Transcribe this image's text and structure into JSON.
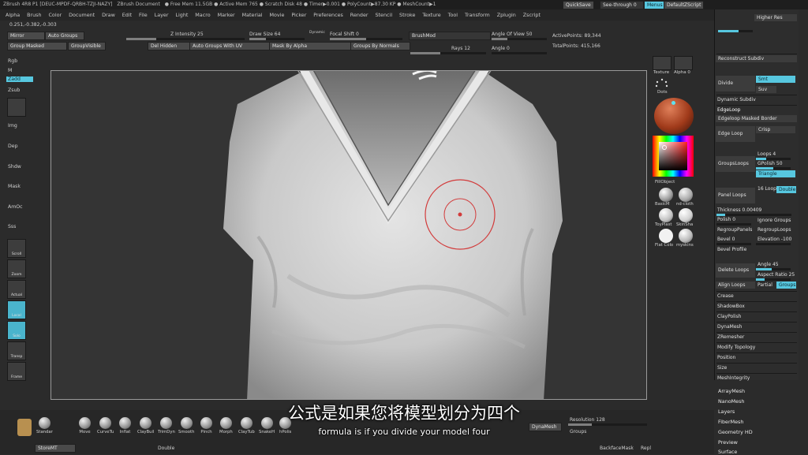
{
  "titlebar": {
    "app": "ZBrush 4R8 P1 [DEUC-MPDF-QRBH-TZJI-NAZY]",
    "doc": "ZBrush Document",
    "stats": "● Free Mem 11.5GB ● Active Mem 765 ● Scratch Disk 48 ● Timer▶0.001 ● PolyCount▶87.30 KP ● MeshCount▶1",
    "quicksave": "QuickSave",
    "seethrough": "See-through 0",
    "menus": "Menus",
    "script": "DefaultZScript"
  },
  "menu": [
    "Alpha",
    "Brush",
    "Color",
    "Document",
    "Draw",
    "Edit",
    "File",
    "Layer",
    "Light",
    "Macro",
    "Marker",
    "Material",
    "Movie",
    "Picker",
    "Preferences",
    "Render",
    "Stencil",
    "Stroke",
    "Texture",
    "Tool",
    "Transform",
    "Zplugin",
    "Zscript"
  ],
  "coords": "0.251,-0.382,-0.303",
  "toolbar": {
    "mirror": "Mirror",
    "auto_groups": "Auto Groups",
    "group_masked": "Group Masked",
    "group_visible": "GroupVisible",
    "del_hidden": "Del Hidden",
    "auto_groups_uv": "Auto Groups With UV",
    "mask_by_alpha": "Mask By Alpha",
    "groups_by_normals": "Groups By Normals",
    "z_intensity": "Z Intensity 25",
    "draw_size": "Draw Size 64",
    "dynamic": "Dynamic",
    "focal_shift": "Focal Shift 0",
    "brush_mod": "BrushMod",
    "angle_of_view": "Angle Of View 50",
    "rays": "Rays 12",
    "angle": "Angle 0",
    "active_points": "ActivePoints: 89,344",
    "total_points": "TotalPoints: 415,166"
  },
  "left_labels": [
    "Rgb",
    "M",
    "Zadd",
    "Zsub",
    "Img",
    "Dep",
    "Shdw",
    "Mask",
    "AmOc",
    "Sss"
  ],
  "left_tools": [
    "Scroll",
    "Zoom",
    "Actual",
    "Local",
    "Solo",
    "Transp",
    "Frame"
  ],
  "mid_panel": {
    "texture": "Texture",
    "alpha": "Alpha 0",
    "dots": "Dots",
    "fill_object": "FillObject",
    "materials": [
      "BasicM",
      "nd-cloth",
      "ToyPlast",
      "SkinSha",
      "Flat Colo",
      "myskins"
    ]
  },
  "right_panel": {
    "higher_res": "Higher Res",
    "reconstruct": "Reconstruct Subdiv",
    "divide": "Divide",
    "smt": "Smt",
    "suv": "Suv",
    "dynamic_subdiv": "Dynamic Subdiv",
    "edgeloop": "EdgeLoop",
    "edgeloop_masked": "Edgeloop Masked Border",
    "edge_loop": "Edge Loop",
    "crisp": "Crisp",
    "groups_loops": "GroupsLoops",
    "loops": "Loops 4",
    "gpolish": "GPolish 50",
    "triangle": "Triangle",
    "panel_loops": "Panel Loops",
    "loop16": "16 Loop",
    "double": "Double",
    "thickness": "Thickness 0.00409",
    "polish": "Polish 0",
    "ignore_groups": "Ignore Groups",
    "regroup_panels": "RegroupPanels",
    "regroup_loops": "RegroupLoops",
    "bevel": "Bevel 0",
    "elevation": "Elevation -100",
    "bevel_profile": "Bevel Profile",
    "delete_loops": "Delete Loops",
    "angle45": "Angle 45",
    "aspect": "Aspect Ratio 25",
    "align_loops": "Align Loops",
    "partial": "Partial",
    "groups": "Groups",
    "items": [
      "Crease",
      "ShadowBox",
      "ClayPolish",
      "DynaMesh",
      "ZRemesher",
      "Modify Topology",
      "Position",
      "Size",
      "MeshIntegrity"
    ],
    "below": [
      "ArrayMesh",
      "NanoMesh",
      "Layers",
      "FiberMesh",
      "Geometry HD",
      "Preview",
      "Surface"
    ]
  },
  "brushes": [
    "Standar",
    "Move",
    "CurveTu",
    "Inflat",
    "ClayBuil",
    "TrimDyn",
    "Smooth",
    "Pinch",
    "Morph",
    "ClayTub",
    "SnakeH",
    "hPolis"
  ],
  "bottom": {
    "dynamesh": "DynaMesh",
    "resolution": "Resolution 128",
    "groups": "Groups",
    "storemt": "StoreMT",
    "double": "Double",
    "backface": "BackfaceMask",
    "repl": "Repl"
  },
  "subtitles": {
    "cn": "公式是如果您将模型划分为四个",
    "en": "formula is if you divide your model four"
  },
  "colors": {
    "accent": "#57c7df",
    "brush_ring": "#d23b3b"
  }
}
